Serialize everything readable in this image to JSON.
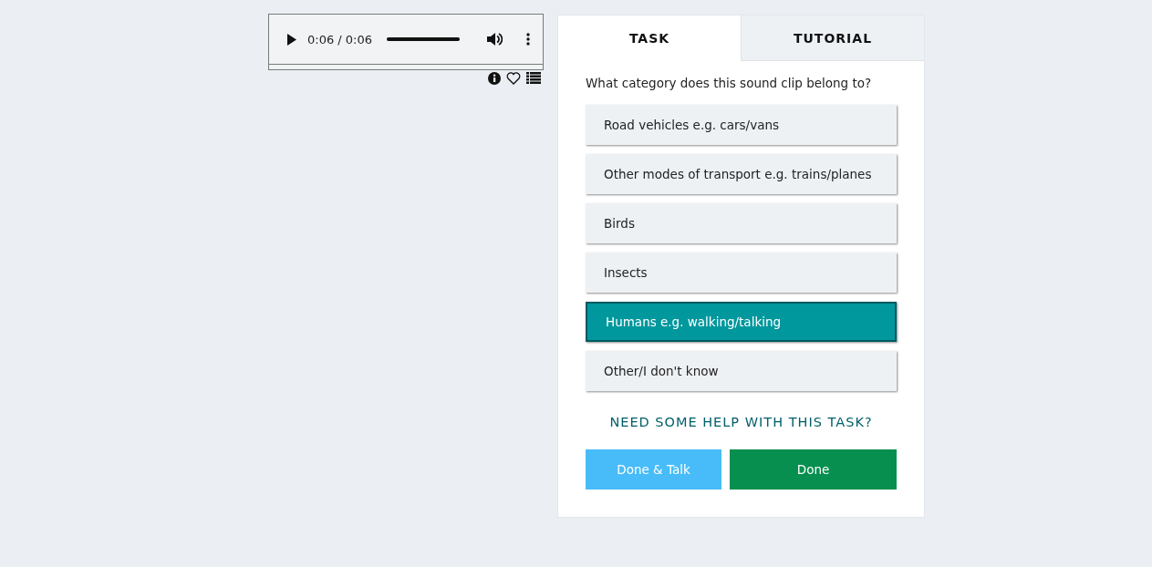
{
  "player": {
    "time": "0:06 / 0:06",
    "level": 1
  },
  "tabs": [
    {
      "label": "TASK",
      "selected": true
    },
    {
      "label": "TUTORIAL",
      "selected": false
    }
  ],
  "question": "What category does this sound clip belong to?",
  "options": [
    {
      "label": "Road vehicles e.g. cars/vans",
      "selected": false
    },
    {
      "label": "Other modes of transport e.g. trains/planes",
      "selected": false
    },
    {
      "label": "Birds",
      "selected": false
    },
    {
      "label": "Insects",
      "selected": false
    },
    {
      "label": "Humans e.g. walking/talking",
      "selected": true
    },
    {
      "label": "Other/I don't know",
      "selected": false
    }
  ],
  "help_link": "NEED SOME HELP WITH THIS TASK?",
  "buttons": [
    {
      "label": "Done & Talk",
      "kind": "talk"
    },
    {
      "label": "Done",
      "kind": "done"
    }
  ]
}
